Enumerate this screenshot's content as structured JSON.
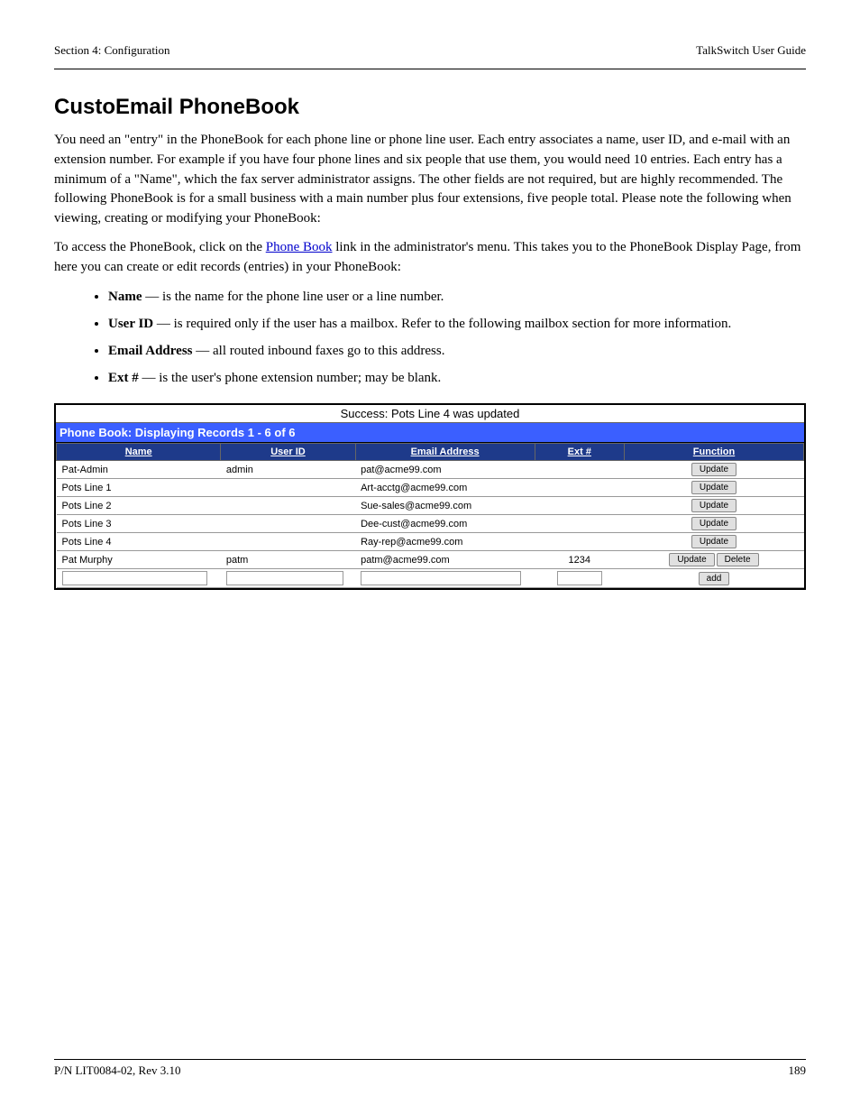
{
  "header": {
    "left": "Section 4: Configuration",
    "right": "TalkSwitch User Guide"
  },
  "section_title": "CustoEmail PhoneBook",
  "p1": "You need an \"entry\" in the PhoneBook for each phone line or phone line user. Each entry associates a name, user ID, and e-mail with an extension number. For example if you have four phone lines and six people that use them, you would need 10 entries. Each entry has a minimum of a \"Name\", which the fax server administrator assigns. The other fields are not required, but are highly recommended. The following PhoneBook is for a small business with a main number plus four extensions, five people total. Please note the following when viewing, creating or modifying your PhoneBook:",
  "p2_prefix": "To access the PhoneBook, click on the ",
  "p2_link": "Phone Book",
  "p2_suffix": " link in the administrator's menu. This takes you to the PhoneBook Display Page, from here you can create or edit records (entries) in your PhoneBook:",
  "bullets": [
    {
      "strong": "Name",
      "text": " — is the name for the phone line user or a line number."
    },
    {
      "strong": "User ID",
      "text": " — is required only if the user has a mailbox. Refer to the following mailbox section for more information."
    },
    {
      "strong": "Email Address",
      "text": " — all routed inbound faxes go to this address."
    },
    {
      "strong": "Ext #",
      "text": " — is the user's phone extension number; may be blank."
    }
  ],
  "table": {
    "status": "Success: Pots Line 4 was updated",
    "title": "Phone Book: Displaying Records 1 - 6 of 6",
    "headers": [
      "Name",
      "User ID",
      "Email Address",
      "Ext #",
      "Function"
    ],
    "rows": [
      {
        "name": "Pat-Admin",
        "uid": "admin",
        "email": "pat@acme99.com",
        "ext": "",
        "update": "Update",
        "delete": ""
      },
      {
        "name": "Pots Line 1",
        "uid": "",
        "email": "Art-acctg@acme99.com",
        "ext": "",
        "update": "Update",
        "delete": ""
      },
      {
        "name": "Pots Line 2",
        "uid": "",
        "email": "Sue-sales@acme99.com",
        "ext": "",
        "update": "Update",
        "delete": ""
      },
      {
        "name": "Pots Line 3",
        "uid": "",
        "email": "Dee-cust@acme99.com",
        "ext": "",
        "update": "Update",
        "delete": ""
      },
      {
        "name": "Pots Line 4",
        "uid": "",
        "email": "Ray-rep@acme99.com",
        "ext": "",
        "update": "Update",
        "delete": ""
      },
      {
        "name": "Pat Murphy",
        "uid": "patm",
        "email": "patm@acme99.com",
        "ext": "1234",
        "update": "Update",
        "delete": "Delete"
      }
    ],
    "add_label": "add"
  },
  "footer": {
    "left": "P/N LIT0084-02, Rev 3.10",
    "right": "189"
  }
}
